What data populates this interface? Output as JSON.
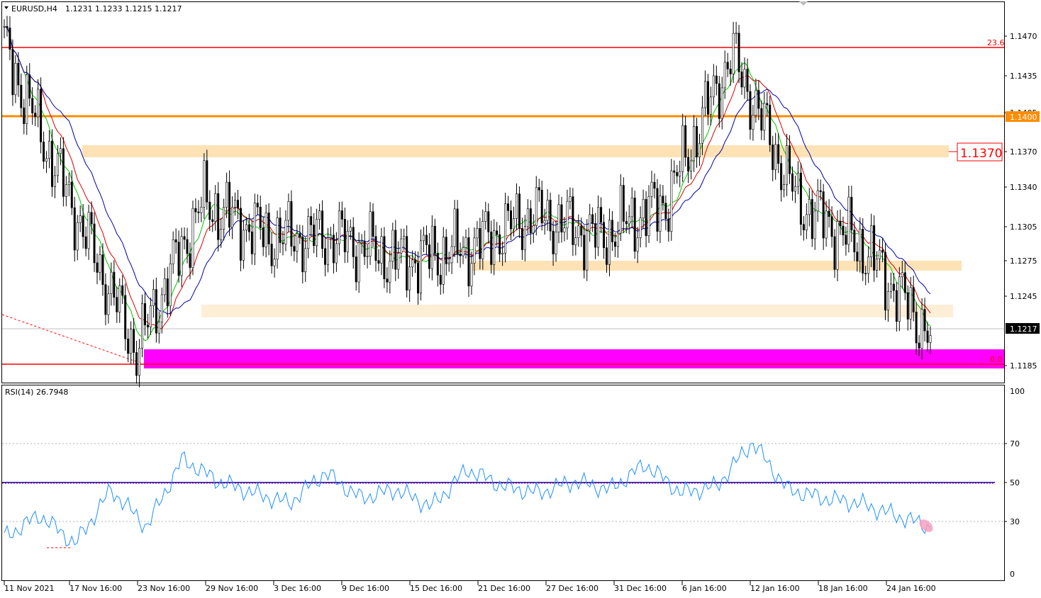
{
  "header": {
    "symbol": "EURUSD,H4",
    "ohlc": "1.1231 1.1233 1.1215 1.1217"
  },
  "rsi_header": "RSI(14) 26.7948",
  "price_axis": {
    "ticks": [
      "1.1470",
      "1.1435",
      "1.1405",
      "1.1370",
      "1.1340",
      "1.1305",
      "1.1275",
      "1.1245",
      "1.1185"
    ],
    "current_price": "1.1217",
    "level_1400": "1.1400",
    "big_label": "1.1370"
  },
  "fib_labels": {
    "top": "23.6",
    "bottom": "0.0"
  },
  "rsi_axis": {
    "ticks": [
      "100",
      "70",
      "50",
      "30",
      "0"
    ]
  },
  "time_axis": [
    "11 Nov 2021",
    "17 Nov 16:00",
    "23 Nov 16:00",
    "29 Nov 16:00",
    "3 Dec 16:00",
    "9 Dec 16:00",
    "15 Dec 16:00",
    "21 Dec 16:00",
    "27 Dec 16:00",
    "31 Dec 16:00",
    "6 Jan 16:00",
    "12 Jan 16:00",
    "18 Jan 16:00",
    "24 Jan 16:00"
  ],
  "colors": {
    "red_level": "#ff0000",
    "orange_level": "#ff8c00",
    "zone": "#fde2b6",
    "zone_light": "#fdeed6",
    "magenta": "#ff00ff",
    "ma_fast": "#00c800",
    "ma_mid": "#dd0000",
    "ma_slow": "#0000aa",
    "rsi": "#1e90ff"
  },
  "chart_data": [
    {
      "type": "candlestick",
      "title": "EURUSD,H4",
      "ylim": [
        1.1175,
        1.1495
      ],
      "horizontal_levels": [
        {
          "value": 1.146,
          "label": "23.6",
          "color": "red"
        },
        {
          "value": 1.14,
          "label": "1.1400",
          "color": "orange"
        },
        {
          "value": 1.1183,
          "label": "0.0",
          "color": "red"
        }
      ],
      "zones": [
        {
          "from": 1.1365,
          "to": 1.1375,
          "label": "1.1370"
        },
        {
          "from": 1.1268,
          "to": 1.1275
        },
        {
          "from": 1.1235,
          "to": 1.1245
        },
        {
          "from": 1.118,
          "to": 1.1193,
          "color": "magenta"
        }
      ],
      "close_path": [
        [
          "11 Nov 2021",
          1.146
        ],
        [
          "17 Nov 16:00",
          1.133
        ],
        [
          "23 Nov 16:00",
          1.1205
        ],
        [
          "29 Nov 16:00",
          1.133
        ],
        [
          "3 Dec 16:00",
          1.13
        ],
        [
          "9 Dec 16:00",
          1.13
        ],
        [
          "15 Dec 16:00",
          1.128
        ],
        [
          "21 Dec 16:00",
          1.129
        ],
        [
          "27 Dec 16:00",
          1.132
        ],
        [
          "31 Dec 16:00",
          1.13
        ],
        [
          "6 Jan 16:00",
          1.133
        ],
        [
          "12 Jan 16:00",
          1.1455
        ],
        [
          "18 Jan 16:00",
          1.133
        ],
        [
          "24 Jan 16:00",
          1.129
        ],
        [
          "24 Jan 16:00+",
          1.1217
        ]
      ]
    },
    {
      "type": "line",
      "title": "RSI(14) 26.7948",
      "ylim": [
        0,
        100
      ],
      "levels": [
        70,
        50,
        30
      ],
      "series": [
        {
          "values": [
            22,
            35,
            18,
            50,
            28,
            68,
            55,
            48,
            42,
            60,
            45,
            50,
            40,
            62,
            52,
            48,
            55,
            50,
            65,
            48,
            52,
            78,
            50,
            45,
            42,
            35,
            28
          ]
        }
      ]
    }
  ]
}
